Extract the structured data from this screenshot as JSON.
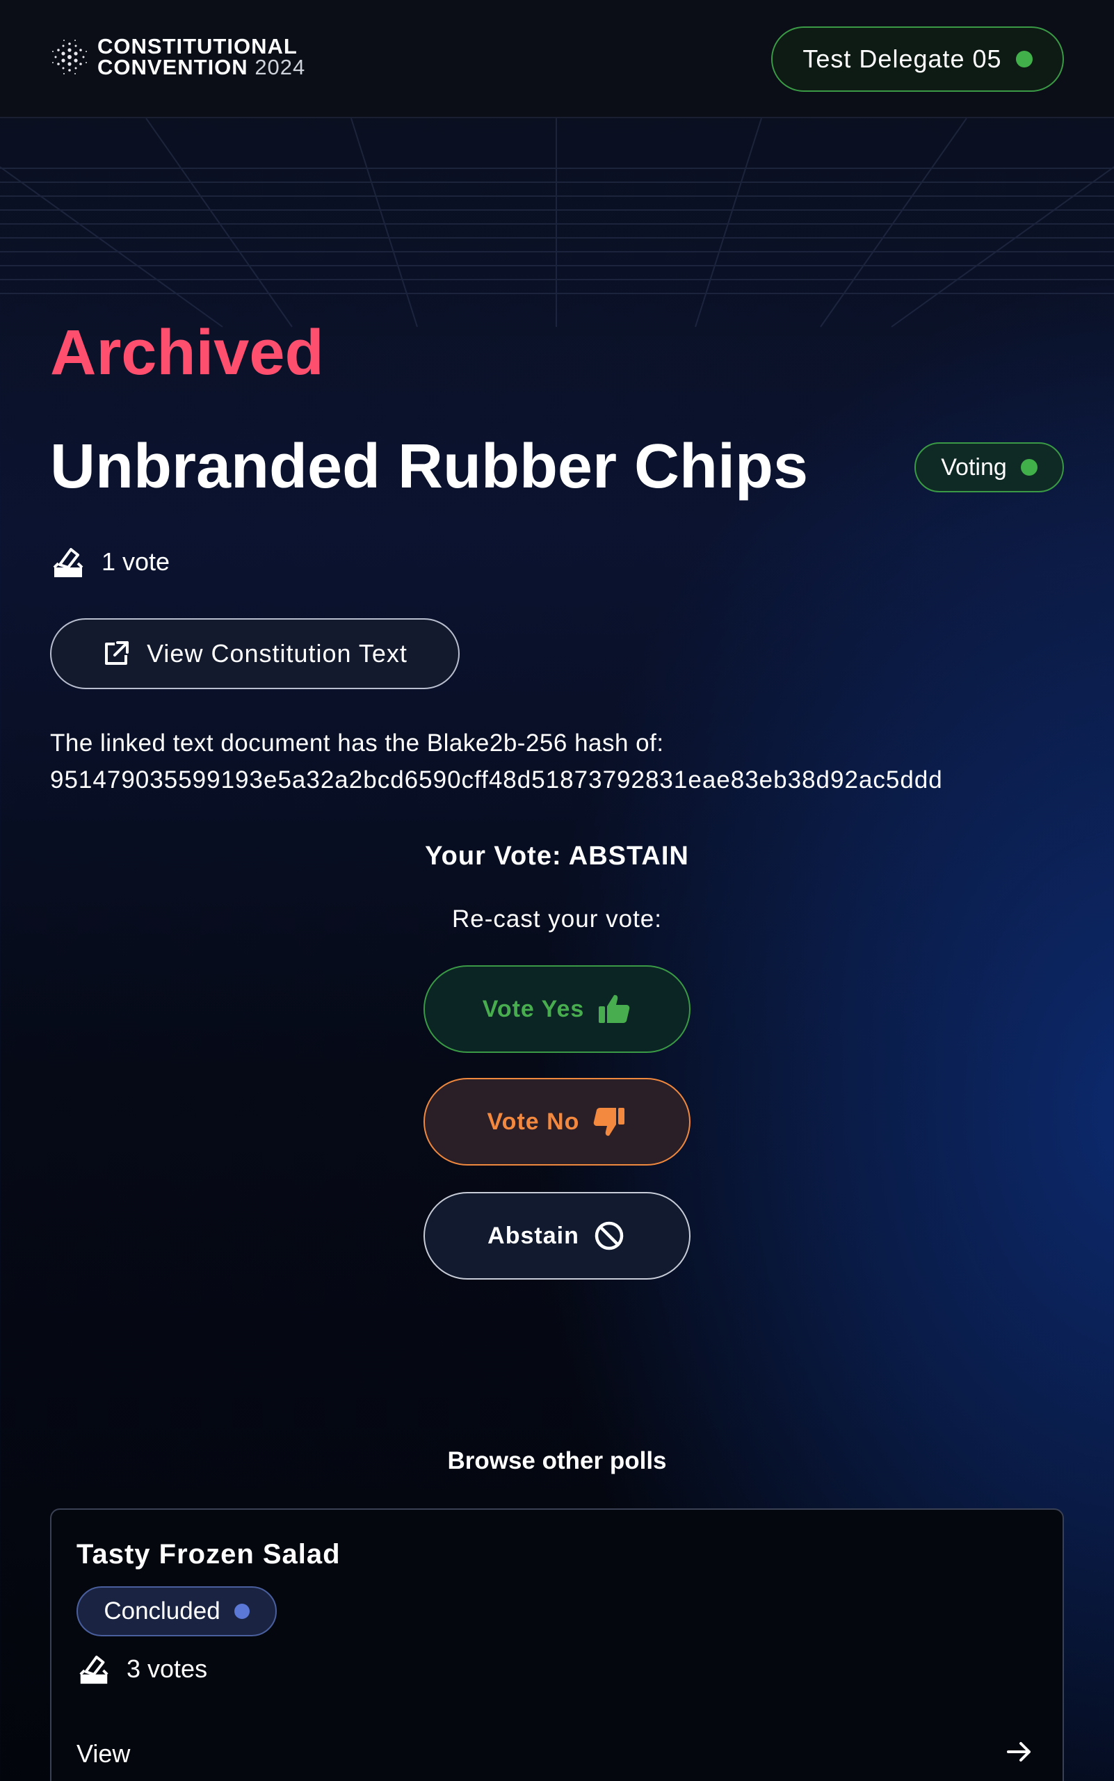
{
  "header": {
    "logo_line1": "CONSTITUTIONAL",
    "logo_line2": "CONVENTION",
    "logo_year": "2024",
    "delegate_name": "Test Delegate 05"
  },
  "poll": {
    "status_label": "Archived",
    "title": "Unbranded Rubber Chips",
    "badge": "Voting",
    "votes": "1 vote",
    "view_button": "View Constitution Text",
    "hash_label": "The linked text document has the Blake2b-256 hash of:",
    "hash": "951479035599193e5a32a2bcd6590cff48d51873792831eae83eb38d92ac5ddd",
    "your_vote_label": "Your Vote:",
    "your_vote_value": "ABSTAIN",
    "recast_label": "Re-cast your vote:",
    "vote_yes": "Vote Yes",
    "vote_no": "Vote No",
    "abstain": "Abstain"
  },
  "browse": {
    "heading": "Browse other polls",
    "cards": [
      {
        "title": "Tasty Frozen Salad",
        "badge": "Concluded",
        "votes": "3 votes",
        "view": "View"
      }
    ]
  },
  "colors": {
    "archived": "#ff4f6e",
    "voting_green": "#41b04a",
    "no_orange": "#f3893f",
    "concluded_blue": "#5b78d6"
  },
  "icons": [
    "cardano-logo-icon",
    "ballot-box-icon",
    "external-link-icon",
    "thumbs-up-icon",
    "thumbs-down-icon",
    "ban-icon",
    "arrow-right-icon"
  ]
}
